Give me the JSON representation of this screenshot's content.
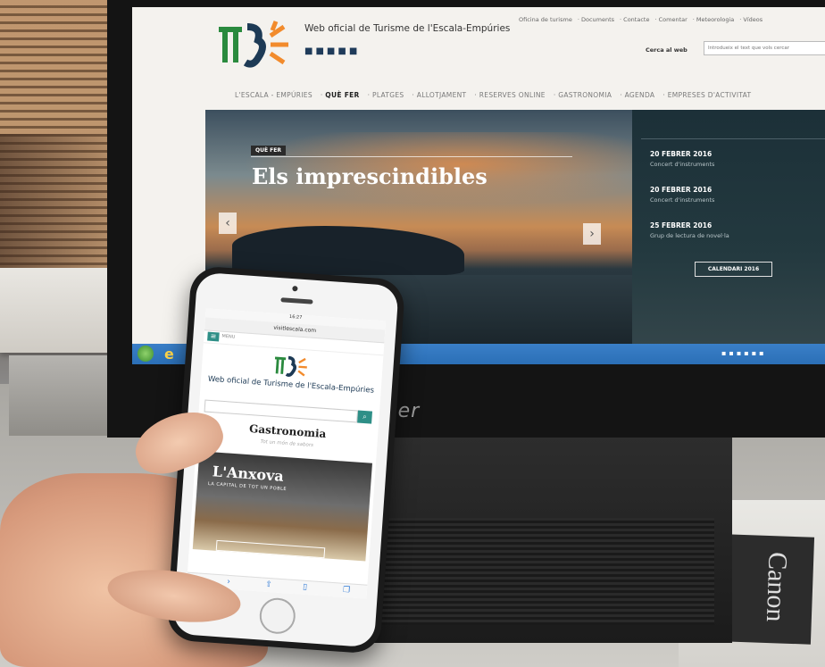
{
  "monitor": {
    "brand": "acer",
    "website": {
      "title": "Web oficial de Turisme de l'Escala-Empúries",
      "top_links": [
        "Oficina de turisme",
        "Documents",
        "Contacte",
        "Comentar",
        "Meteorologia",
        "Vídeos"
      ],
      "search_label": "Cerca al web",
      "search_placeholder": "Introdueix el text que vols cercar",
      "nav": [
        "L'ESCALA - EMPÚRIES",
        "QUÈ FER",
        "PLATGES",
        "ALLOTJAMENT",
        "RESERVES ONLINE",
        "GASTRONOMIA",
        "AGENDA",
        "EMPRESES D'ACTIVITAT"
      ],
      "active_nav": "QUÈ FER",
      "hero": {
        "tag": "QUÈ FER",
        "title": "Els imprescindibles"
      },
      "agenda": [
        {
          "date": "20 FEBRER 2016",
          "event": "Concert d'instruments"
        },
        {
          "date": "20 FEBRER 2016",
          "event": "Concert d'instruments"
        },
        {
          "date": "25 FEBRER 2016",
          "event": "Grup de lectura de novel·la"
        }
      ],
      "calendar_button": "CALENDARI 2016"
    }
  },
  "phone": {
    "status_time": "16:27",
    "url": "visitlescala.com",
    "menu_label": "MENU",
    "title": "Web oficial de Turisme de l'Escala-Empúries",
    "section": "Gastronomia",
    "subtitle": "Tot un món de sabors",
    "card": {
      "title": "L'Anxova",
      "subtitle": "LA CAPITAL DE TOT UN POBLE"
    }
  },
  "box_text": "Canon",
  "colors": {
    "teal": "#2e8f87",
    "navy": "#1d3a55",
    "logo_green": "#2a8a3e",
    "logo_orange": "#f28b2c",
    "taskbar": "#2b6fb6"
  }
}
